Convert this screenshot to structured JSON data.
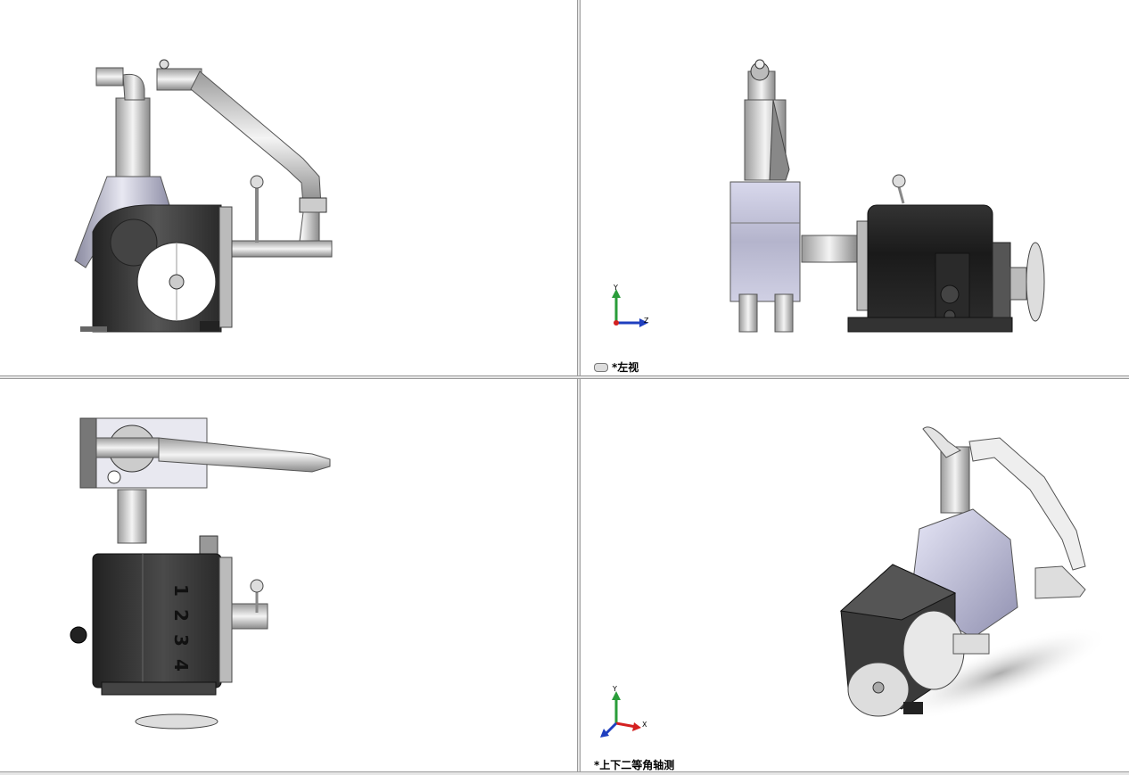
{
  "toolbar": {
    "items": [
      {
        "name": "zoom-to-fit-icon",
        "dropdown": false
      },
      {
        "name": "zoom-to-area-icon",
        "dropdown": false
      },
      {
        "name": "previous-view-icon",
        "dropdown": false
      },
      {
        "name": "section-view-icon",
        "dropdown": false
      },
      {
        "name": "dynamic-annotation-icon",
        "dropdown": false
      },
      {
        "name": "view-orientation-icon",
        "dropdown": true
      },
      {
        "name": "display-style-icon",
        "dropdown": true
      },
      {
        "name": "hide-show-items-icon",
        "dropdown": true
      },
      {
        "name": "edit-appearance-icon",
        "dropdown": false
      },
      {
        "name": "apply-scene-icon",
        "dropdown": true
      },
      {
        "name": "view-settings-icon",
        "dropdown": true
      }
    ]
  },
  "viewports": {
    "top_right": {
      "label": "*左视"
    },
    "bottom_right": {
      "label": "*上下二等角轴测"
    }
  },
  "triads": {
    "left": {
      "axis1": "Y",
      "axis2": "Z"
    },
    "iso": {
      "axis1": "Y",
      "axis2": "X"
    }
  },
  "parts": {
    "top_view_digits": [
      "1",
      "2",
      "3",
      "4"
    ]
  },
  "colors": {
    "body_dark": "#3a3a3a",
    "body_light": "#c8c8d8",
    "pipe": "#e0e0e0",
    "triad_y": "#2a9d3a",
    "triad_z": "#1f3fbf",
    "triad_x": "#d42020"
  }
}
